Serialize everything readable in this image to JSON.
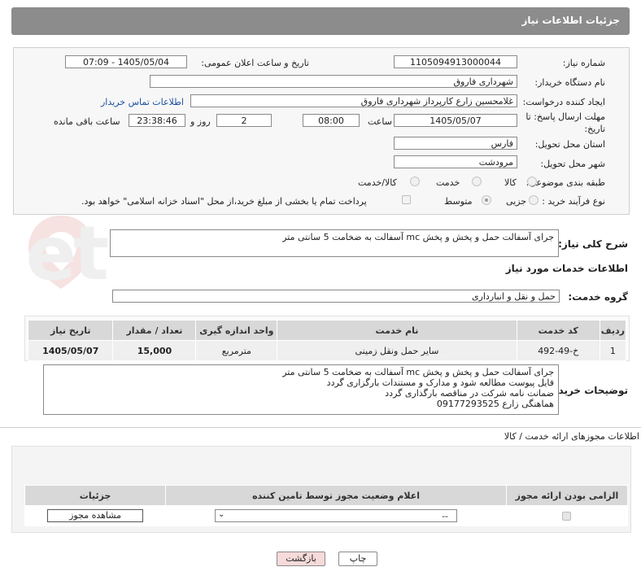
{
  "header": {
    "title": "جزئیات اطلاعات نیاز"
  },
  "form": {
    "need_number_label": "شماره نیاز:",
    "need_number": "1105094913000044",
    "announce_label": "تاریخ و ساعت اعلان عمومی:",
    "announce_value": "1405/05/04 - 07:09",
    "buyer_label": "نام دستگاه خریدار:",
    "buyer": "شهرداری فاروق",
    "creator_label": "ایجاد کننده درخواست:",
    "creator": "غلامحسین زارع کارپرداز شهرداری فاروق",
    "contact_link": "اطلاعات تماس خریدار",
    "deadline_label_1": "مهلت ارسال پاسخ: تا",
    "deadline_label_2": "تاریخ:",
    "deadline_date": "1405/05/07",
    "time_label": "ساعت",
    "deadline_time": "08:00",
    "days_value": "2",
    "days_label": "روز و",
    "remaining_time": "23:38:46",
    "remaining_label": "ساعت باقی مانده",
    "province_label": "استان محل تحویل:",
    "province": "فارس",
    "city_label": "شهر محل تحویل:",
    "city": "مرودشت",
    "category_label": "طبقه بندی موضوعی:",
    "category_options": [
      "کالا",
      "خدمت",
      "کالا/خدمت"
    ],
    "process_label": "نوع فرآیند خرید :",
    "process_options": [
      "جزیی",
      "متوسط"
    ],
    "payment_note": "پرداخت تمام یا بخشی از مبلغ خرید،از محل \"اسناد خزانه اسلامی\" خواهد بود."
  },
  "description": {
    "label": "شرح کلی نیاز:",
    "text": "جرای آسفالت حمل و پخش و پخش mc  آسفالت به ضخامت 5 سانتی متر"
  },
  "services": {
    "section_title": "اطلاعات خدمات مورد نیاز",
    "group_label": "گروه خدمت:",
    "group_value": "حمل و نقل و انبارداری",
    "columns": [
      "ردیف",
      "کد خدمت",
      "نام خدمت",
      "واحد اندازه گیری",
      "تعداد / مقدار",
      "تاریخ نیاز"
    ],
    "rows": [
      [
        "1",
        "خ-49-492",
        "سایر حمل ونقل زمینی",
        "مترمربع",
        "15,000",
        "1405/05/07"
      ]
    ]
  },
  "buyer_notes": {
    "label": "توضیحات خریدار:",
    "text": "جرای آسفالت حمل و پخش و پخش mc  آسفالت به ضخامت 5 سانتی متر\nفایل پیوست مطالعه شود و مدارک و مستندات بارگزاری گردد\nضمانت نامه شرکت در مناقصه بارگذاری گردد\nهماهنگی زارع 09177293525"
  },
  "permits": {
    "section_title": "اطلاعات مجوزهای ارائه خدمت / کالا",
    "columns": [
      "الزامی بودن ارائه مجوز",
      "اعلام وضعیت مجوز توسط تامین کننده",
      "جزئیات"
    ],
    "select_value": "--",
    "view_button": "مشاهده مجوز"
  },
  "actions": {
    "print": "چاپ",
    "back": "بازگشت"
  },
  "watermark": "AriaTender.net",
  "colors": {
    "header_bg": "#8c8c8c",
    "link": "#1a4fa0",
    "back_button": "#f7dada"
  }
}
